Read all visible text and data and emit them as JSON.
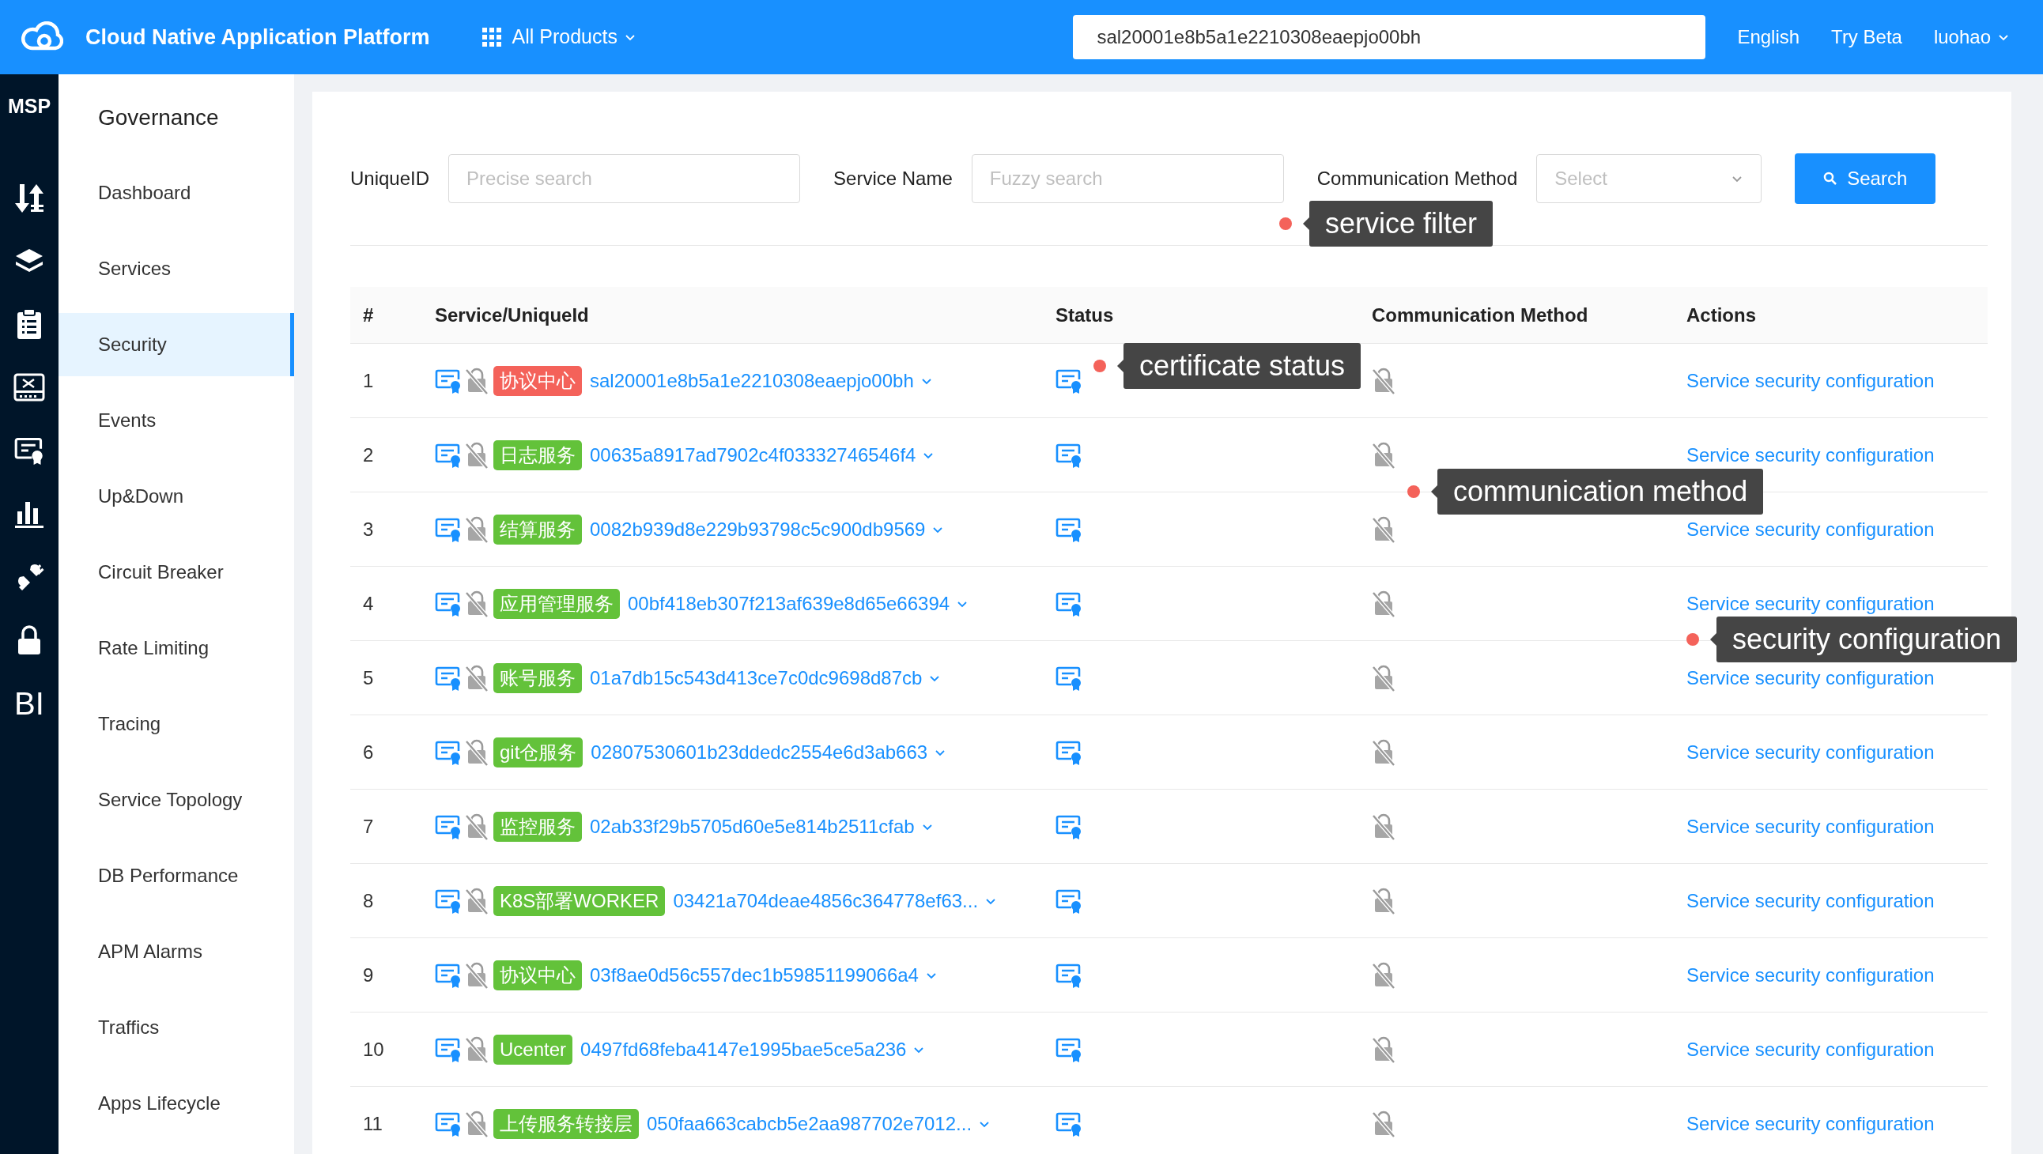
{
  "header": {
    "title": "Cloud Native Application Platform",
    "products": "All Products",
    "search": {
      "value": "sal20001e8b5a1e2210308eaepjo00bh"
    },
    "links": [
      "English",
      "Try Beta"
    ],
    "user": "luohao"
  },
  "rail": {
    "title": "MSP",
    "items": [
      {
        "kind": "updown",
        "selected": false
      },
      {
        "kind": "layers",
        "selected": false
      },
      {
        "kind": "clipboard",
        "selected": false
      },
      {
        "kind": "switch",
        "selected": false
      },
      {
        "kind": "certificate",
        "selected": false
      },
      {
        "kind": "chart",
        "selected": false
      },
      {
        "kind": "plug",
        "selected": false
      },
      {
        "kind": "lock",
        "selected": false
      },
      {
        "kind": "text",
        "label": "BI",
        "selected": false
      }
    ]
  },
  "sidebar": {
    "title": "Governance",
    "items": [
      {
        "label": "Dashboard",
        "selected": false
      },
      {
        "label": "Services",
        "selected": false
      },
      {
        "label": "Security",
        "selected": true
      },
      {
        "label": "Events",
        "selected": false
      },
      {
        "label": "Up&Down",
        "selected": false
      },
      {
        "label": "Circuit Breaker",
        "selected": false
      },
      {
        "label": "Rate Limiting",
        "selected": false
      },
      {
        "label": "Tracing",
        "selected": false
      },
      {
        "label": "Service Topology",
        "selected": false
      },
      {
        "label": "DB Performance",
        "selected": false
      },
      {
        "label": "APM Alarms",
        "selected": false
      },
      {
        "label": "Traffics",
        "selected": false
      },
      {
        "label": "Apps Lifecycle",
        "selected": false
      }
    ]
  },
  "filters": {
    "fields": [
      {
        "label": "UniqueID",
        "kind": "input",
        "placeholder": "Precise search"
      },
      {
        "label": "Service Name",
        "kind": "input",
        "placeholder": "Fuzzy search"
      },
      {
        "label": "Communication Method",
        "kind": "select",
        "placeholder": "Select"
      }
    ],
    "button": "Search",
    "annotation": "service filter"
  },
  "table": {
    "columns": [
      "#",
      "Service/UniqueId",
      "Status",
      "Communication Method",
      "Actions"
    ],
    "rows": [
      {
        "index": "1",
        "tag": "协议中心",
        "color": "#f4625a",
        "id": "sal20001e8b5a1e2210308eaepjo00bh",
        "action": "Service security configuration",
        "annotation": {
          "kind": "status",
          "text": "certificate status"
        }
      },
      {
        "index": "2",
        "tag": "日志服务",
        "color": "#63c23a",
        "id": "00635a8917ad7902c4f03332746546f4",
        "action": "Service security configuration",
        "annotation": {
          "kind": "method",
          "text": "communication method"
        }
      },
      {
        "index": "3",
        "tag": "结算服务",
        "color": "#63c23a",
        "id": "0082b939d8e229b93798c5c900db9569",
        "action": "Service security configuration"
      },
      {
        "index": "4",
        "tag": "应用管理服务",
        "color": "#63c23a",
        "id": "00bf418eb307f213af639e8d65e66394",
        "action": "Service security configuration",
        "annotation": {
          "kind": "action",
          "text": "security configuration"
        }
      },
      {
        "index": "5",
        "tag": "账号服务",
        "color": "#63c23a",
        "id": "01a7db15c543d413ce7c0dc9698d87cb",
        "action": "Service security configuration"
      },
      {
        "index": "6",
        "tag": "git仓服务",
        "color": "#63c23a",
        "id": "02807530601b23ddedc2554e6d3ab663",
        "action": "Service security configuration"
      },
      {
        "index": "7",
        "tag": "监控服务",
        "color": "#63c23a",
        "id": "02ab33f29b5705d60e5e814b2511cfab",
        "action": "Service security configuration"
      },
      {
        "index": "8",
        "tag": "K8S部署WORKER",
        "color": "#63c23a",
        "id": "03421a704deae4856c364778ef63...",
        "action": "Service security configuration"
      },
      {
        "index": "9",
        "tag": "协议中心",
        "color": "#63c23a",
        "id": "03f8ae0d56c557dec1b59851199066a4",
        "action": "Service security configuration"
      },
      {
        "index": "10",
        "tag": "Ucenter",
        "color": "#63c23a",
        "id": "0497fd68feba4147e1995bae5ce5a236",
        "action": "Service security configuration"
      },
      {
        "index": "11",
        "tag": "上传服务转接层",
        "color": "#63c23a",
        "id": "050faa663cabcb5e2aa987702e7012...",
        "action": "Service security configuration"
      }
    ]
  }
}
